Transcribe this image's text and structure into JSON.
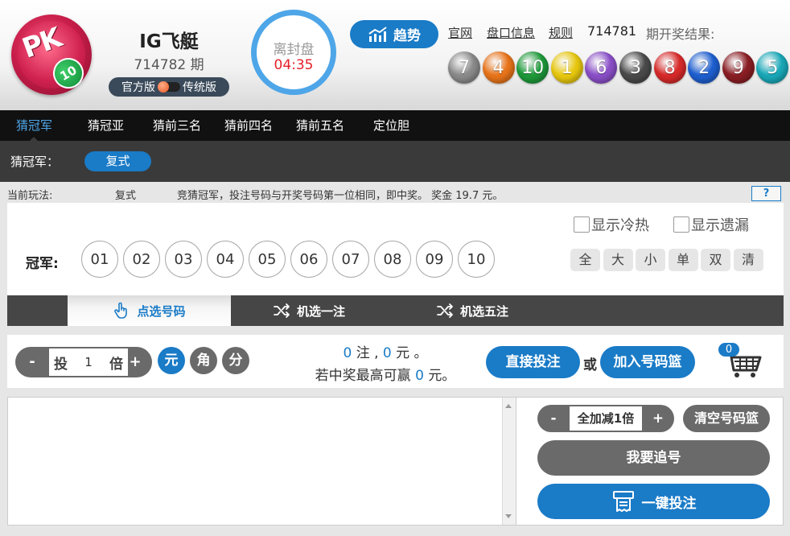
{
  "header": {
    "game_title": "IG飞艇",
    "period": "714782 期",
    "version_official": "官方版",
    "version_traditional": "传统版",
    "countdown_label": "离封盘",
    "countdown_time": "04:35",
    "trend_label": "趋势",
    "links": [
      "官网",
      "盘口信息",
      "规则"
    ],
    "last_period": "714781",
    "result_label": "期开奖结果:",
    "results": [
      {
        "n": "7",
        "color": "#8a8a8a"
      },
      {
        "n": "4",
        "color": "#e8741a"
      },
      {
        "n": "10",
        "color": "#1e9a3a"
      },
      {
        "n": "1",
        "color": "#e8c80e"
      },
      {
        "n": "6",
        "color": "#8a4fc8"
      },
      {
        "n": "3",
        "color": "#4a4a4a"
      },
      {
        "n": "8",
        "color": "#d82a2a"
      },
      {
        "n": "2",
        "color": "#1e5fd0"
      },
      {
        "n": "9",
        "color": "#8a1e24"
      },
      {
        "n": "5",
        "color": "#19a8b8"
      }
    ]
  },
  "nav": {
    "items": [
      "猜冠军",
      "猜冠亚",
      "猜前三名",
      "猜前四名",
      "猜前五名",
      "定位胆"
    ]
  },
  "subbar": {
    "label": "猜冠军：",
    "pill": "复式"
  },
  "info": {
    "label": "当前玩法:",
    "mode": "复式",
    "desc": "竞猜冠军，投注号码与开奖号码第一位相同，即中奖。 奖金 19.7 元。",
    "help": "?"
  },
  "panel": {
    "show_hot": "显示冷热",
    "show_miss": "显示遗漏",
    "row_label": "冠军:",
    "numbers": [
      "01",
      "02",
      "03",
      "04",
      "05",
      "06",
      "07",
      "08",
      "09",
      "10"
    ],
    "filters": [
      "全",
      "大",
      "小",
      "单",
      "双",
      "清"
    ]
  },
  "modes": {
    "pick": "点选号码",
    "random_one": "机选一注",
    "random_five": "机选五注"
  },
  "bet": {
    "minus": "-",
    "plus": "+",
    "tou": "投",
    "multiplier": "1",
    "bei": "倍",
    "units": [
      "元",
      "角",
      "分"
    ],
    "count": "0",
    "zhu": "注 ,",
    "amount": "0",
    "yuan": "元 。",
    "win_prefix": "若中奖最高可赢",
    "win_amount": "0",
    "win_suffix": "元。",
    "direct_bet": "直接投注",
    "or": "或",
    "add_basket": "加入号码篮",
    "cart_count": "0"
  },
  "right": {
    "minus": "-",
    "all_mult": "全加减1倍",
    "plus": "+",
    "clear_basket": "清空号码篮",
    "chase": "我要追号",
    "one_key": "一键投注"
  },
  "colors": {
    "accent": "#1a7bc7",
    "countdown_ring": "#4ea6e8",
    "countdown_time": "#e5202a",
    "nav_bg": "#111111",
    "dark_btn": "#6a6a6a"
  }
}
